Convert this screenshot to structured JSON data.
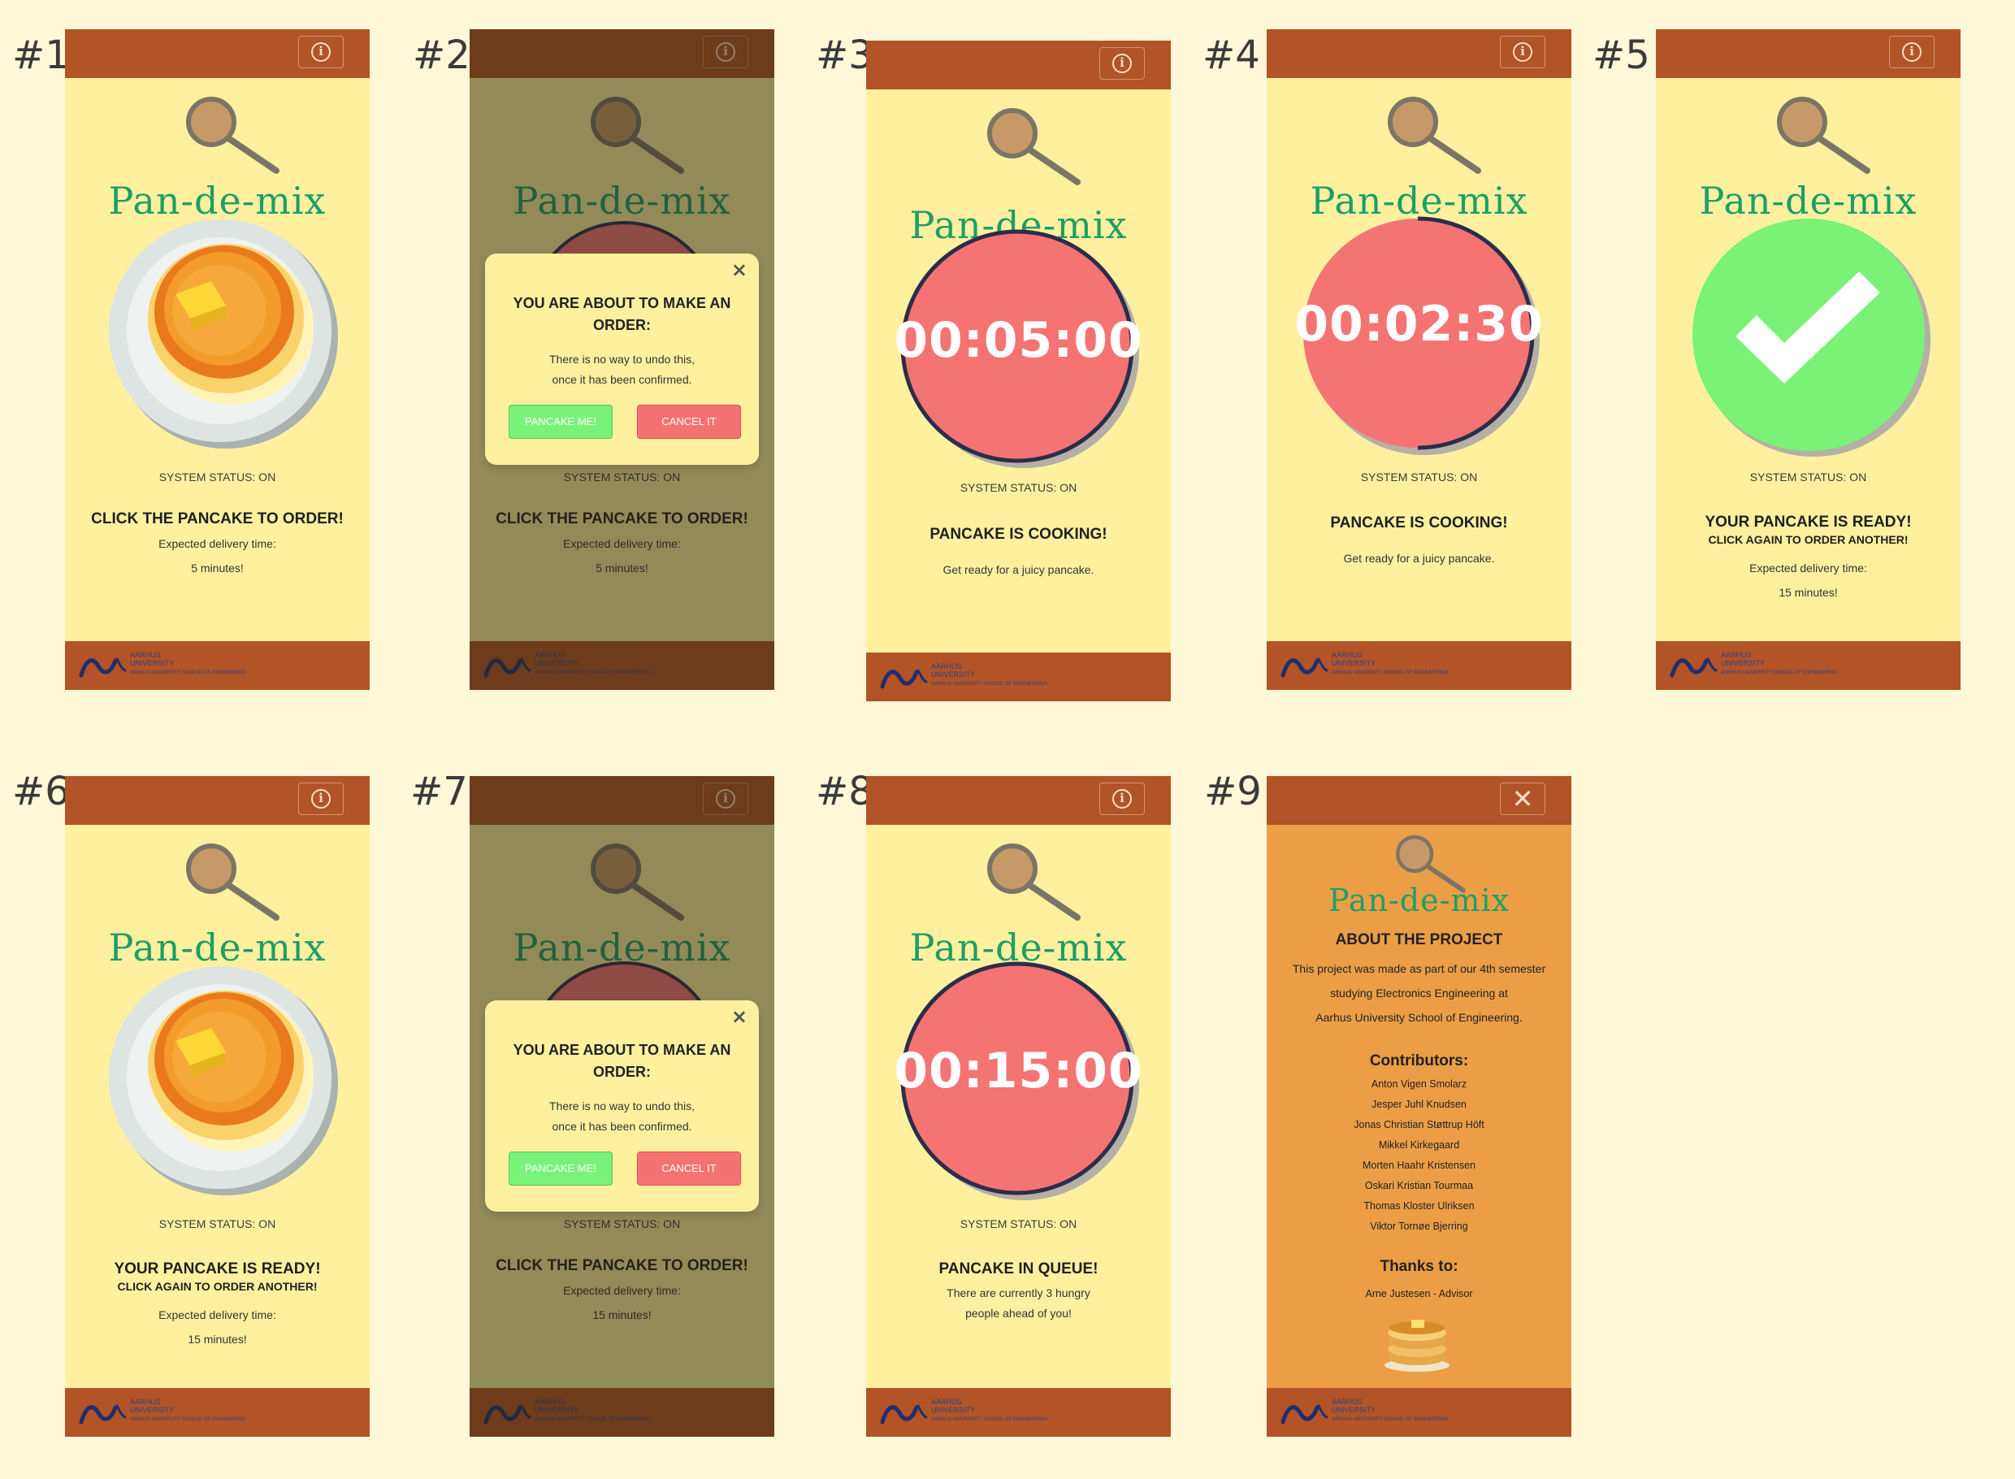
{
  "slots": [
    {
      "label": "#1"
    },
    {
      "label": "#2"
    },
    {
      "label": "#3"
    },
    {
      "label": "#4"
    },
    {
      "label": "#5"
    },
    {
      "label": "#6"
    },
    {
      "label": "#7"
    },
    {
      "label": "#8"
    },
    {
      "label": "#9"
    }
  ],
  "brand": "Pan-de-mix",
  "status": "SYSTEM STATUS: ON",
  "click_to_order": "CLICK THE PANCAKE TO ORDER!",
  "expected_label": "Expected delivery time:",
  "delivery_5": "5 minutes!",
  "delivery_15": "15 minutes!",
  "cooking": "PANCAKE IS COOKING!",
  "juicy": "Get ready for a juicy pancake.",
  "ready": "YOUR PANCAKE IS READY!",
  "order_again": "CLICK AGAIN TO ORDER ANOTHER!",
  "queue": {
    "title": "PANCAKE IN QUEUE!",
    "line1": "There are currently 3 hungry",
    "line2": "people ahead of you!"
  },
  "timers": {
    "t3": "00:05:00",
    "t4": "00:02:30",
    "t8": "00:15:00"
  },
  "timer_progress": {
    "t3": 1.0,
    "t4": 0.5,
    "t8": 1.0
  },
  "modal": {
    "title": "YOU ARE ABOUT TO MAKE AN ORDER:",
    "line1": "There is no way to undo this,",
    "line2": "once it has been confirmed.",
    "confirm": "PANCAKE ME!",
    "cancel": "CANCEL IT",
    "close": "×"
  },
  "footer": {
    "line1": "AARHUS",
    "line2": "UNIVERSITY",
    "line3": "AARHUS UNIVERSITY SCHOOL OF ENGINEERING"
  },
  "about": {
    "title": "ABOUT THE PROJECT",
    "body": [
      "This project was made as part of our 4th semester",
      "studying Electronics Engineering at",
      "Aarhus University School of Engineering."
    ],
    "contributors_title": "Contributors:",
    "contributors": [
      "Anton Vigen Smolarz",
      "Jesper Juhl Knudsen",
      "Jonas Christian Støttrup Höft",
      "Mikkel Kirkegaard",
      "Morten Haahr Kristensen",
      "Oskari Kristian Tourmaa",
      "Thomas Kloster Ulriksen",
      "Viktor Tornøe Bjerring"
    ],
    "thanks_title": "Thanks to:",
    "thanks": "Arne Justesen - Advisor",
    "close": "✕"
  },
  "colors": {
    "page_bg": "#FFF8D8",
    "screen_bg": "#FFF0A0",
    "bar": "#B25427",
    "brand": "#1E9E68",
    "timer_red": "#F47474",
    "check_green": "#79F277",
    "about_bg": "#EB9E45"
  },
  "icons": {
    "info": "info-circle-icon",
    "pan": "frying-pan-icon",
    "check": "check-icon",
    "close": "close-icon"
  }
}
